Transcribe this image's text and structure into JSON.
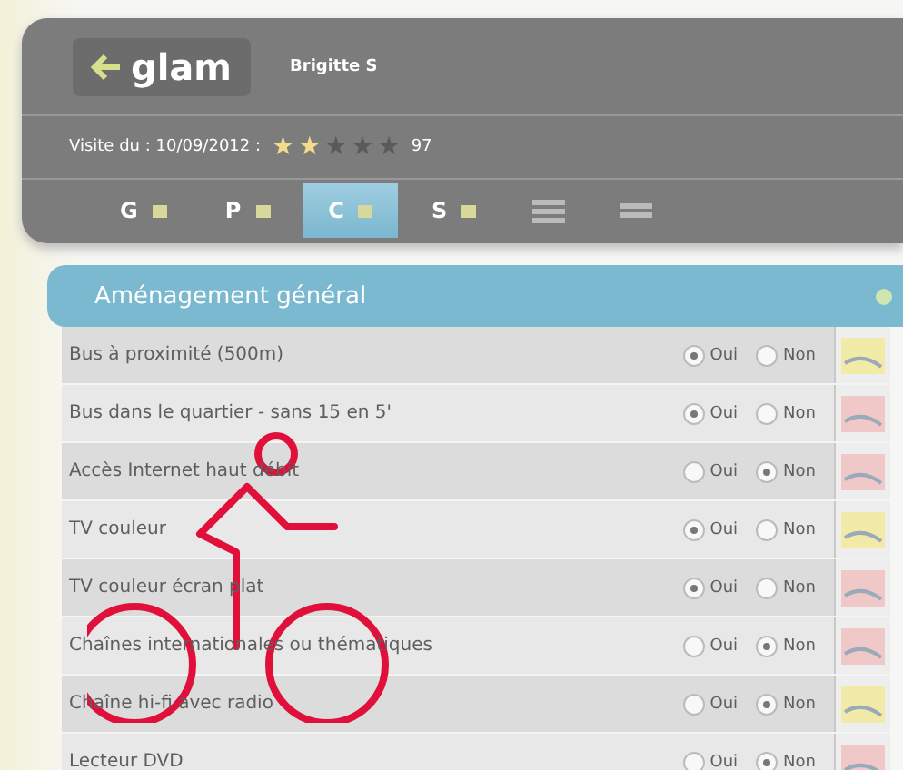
{
  "header": {
    "logo": "glam",
    "user": "Brigitte S",
    "visit_label": "Visite du : 10/09/2012 :",
    "stars": 2,
    "score": "97"
  },
  "tabs": [
    {
      "label": "G",
      "selected": false
    },
    {
      "label": "P",
      "selected": false
    },
    {
      "label": "C",
      "selected": true
    },
    {
      "label": "S",
      "selected": false
    }
  ],
  "section": {
    "title": "Aménagement général"
  },
  "rows": [
    {
      "label": "Bus à proximité (500m)",
      "options": [
        {
          "label": "Oui",
          "selected": true
        },
        {
          "label": "Non",
          "selected": false
        }
      ]
    },
    {
      "label": "Bus dans le quartier - sans 15 en 5'",
      "options": [
        {
          "label": "Oui",
          "selected": true
        },
        {
          "label": "Non",
          "selected": false
        }
      ]
    },
    {
      "label": "Accès Internet haut débit",
      "options": [
        {
          "label": "Oui",
          "selected": false
        },
        {
          "label": "Non",
          "selected": true
        }
      ]
    },
    {
      "label": "TV couleur",
      "options": [
        {
          "label": "Oui",
          "selected": true
        },
        {
          "label": "Non",
          "selected": false
        }
      ]
    },
    {
      "label": "TV couleur écran plat",
      "options": [
        {
          "label": "Oui",
          "selected": true
        },
        {
          "label": "Non",
          "selected": false
        }
      ]
    },
    {
      "label": "Chaînes internationales ou thématiques",
      "options": [
        {
          "label": "Oui",
          "selected": false
        },
        {
          "label": "Non",
          "selected": true
        }
      ]
    },
    {
      "label": "Chaîne hi-fi avec radio",
      "options": [
        {
          "label": "Oui",
          "selected": false
        },
        {
          "label": "Non",
          "selected": true
        }
      ]
    },
    {
      "label": "Lecteur DVD",
      "options": [
        {
          "label": "Oui",
          "selected": false
        },
        {
          "label": "Non",
          "selected": true
        }
      ]
    }
  ]
}
